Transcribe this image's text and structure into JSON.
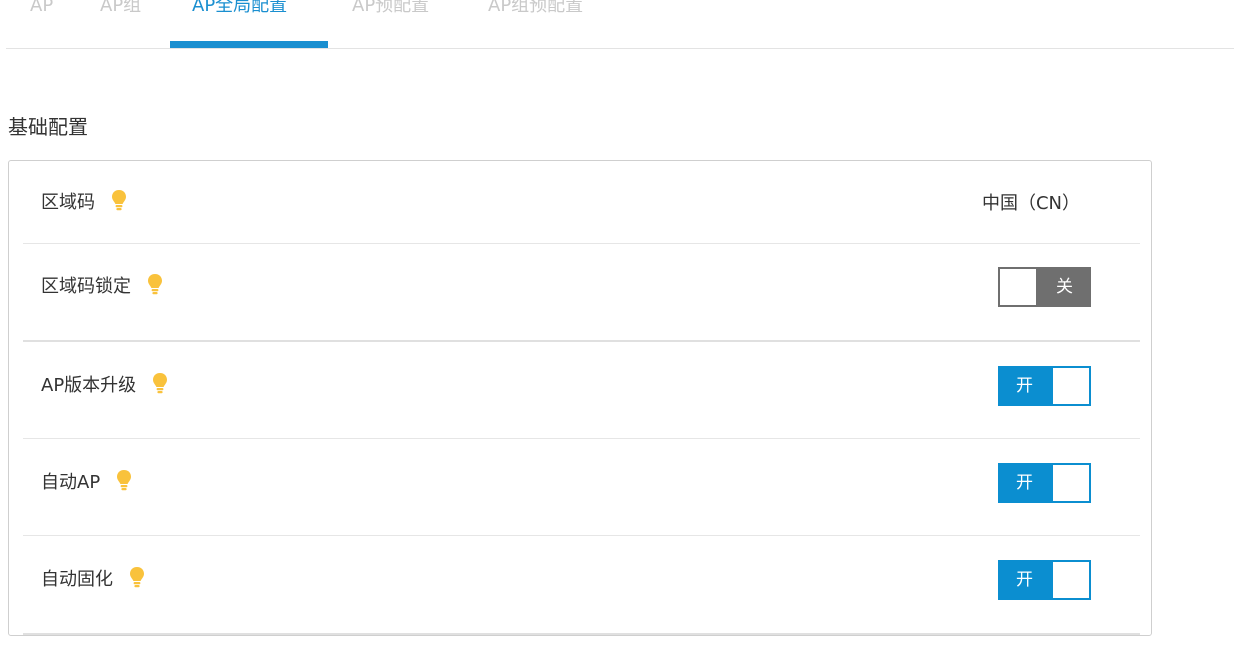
{
  "tabs": [
    {
      "label": "AP",
      "active": false
    },
    {
      "label": "AP组",
      "active": false
    },
    {
      "label": "AP全局配置",
      "active": true
    },
    {
      "label": "AP预配置",
      "active": false
    },
    {
      "label": "AP组预配置",
      "active": false
    }
  ],
  "section_title": "基础配置",
  "rows": [
    {
      "label": "区域码",
      "icon": "lightbulb-icon",
      "value": "中国（CN）"
    },
    {
      "label": "区域码锁定",
      "icon": "lightbulb-icon",
      "toggle": "关",
      "state": "off"
    },
    {
      "label": "AP版本升级",
      "icon": "lightbulb-icon",
      "toggle": "开",
      "state": "on"
    },
    {
      "label": "自动AP",
      "icon": "lightbulb-icon",
      "toggle": "开",
      "state": "on"
    },
    {
      "label": "自动固化",
      "icon": "lightbulb-icon",
      "toggle": "开",
      "state": "on"
    }
  ],
  "colors": {
    "accent": "#0b8ed0",
    "tab_active": "#1a8fd0",
    "toggle_off": "#6f6f6f",
    "bulb": "#f9c23c"
  }
}
